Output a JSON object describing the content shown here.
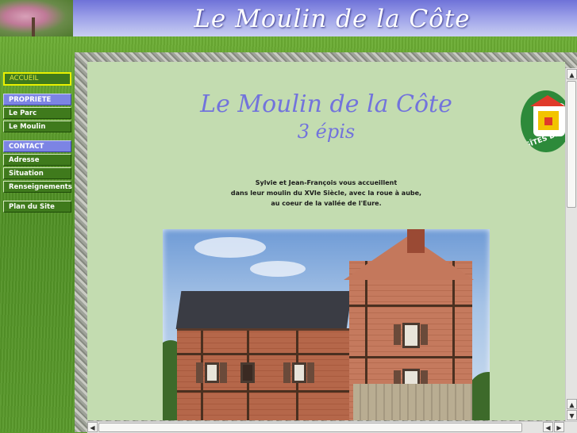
{
  "header": {
    "title": "Le Moulin de la Côte"
  },
  "sidebar": {
    "items": [
      {
        "label": "ACCUEIL"
      },
      {
        "label": "PROPRIETE"
      },
      {
        "label": "Le Parc"
      },
      {
        "label": "Le Moulin"
      },
      {
        "label": "CONTACT"
      },
      {
        "label": "Adresse"
      },
      {
        "label": "Situation"
      },
      {
        "label": "Renseignements"
      },
      {
        "label": "Plan du Site"
      }
    ]
  },
  "main": {
    "title": "Le Moulin de la Côte",
    "subtitle": "3 épis",
    "welcome": [
      "Sylvie et Jean-François vous accueillent",
      "dans leur moulin du XVIe Siècle, avec la roue à aube,",
      "au coeur de la vallée de l'Eure."
    ],
    "badge_text": "GÎTES DE F"
  },
  "colors": {
    "title_color": "#7273dc",
    "content_bg": "#c3dcb0",
    "nav_green": "#3f7a1c",
    "nav_blue": "#7c84e4"
  },
  "icons": {
    "scroll_up": "▲",
    "scroll_down": "▼",
    "scroll_left": "◀",
    "scroll_right": "▶"
  }
}
